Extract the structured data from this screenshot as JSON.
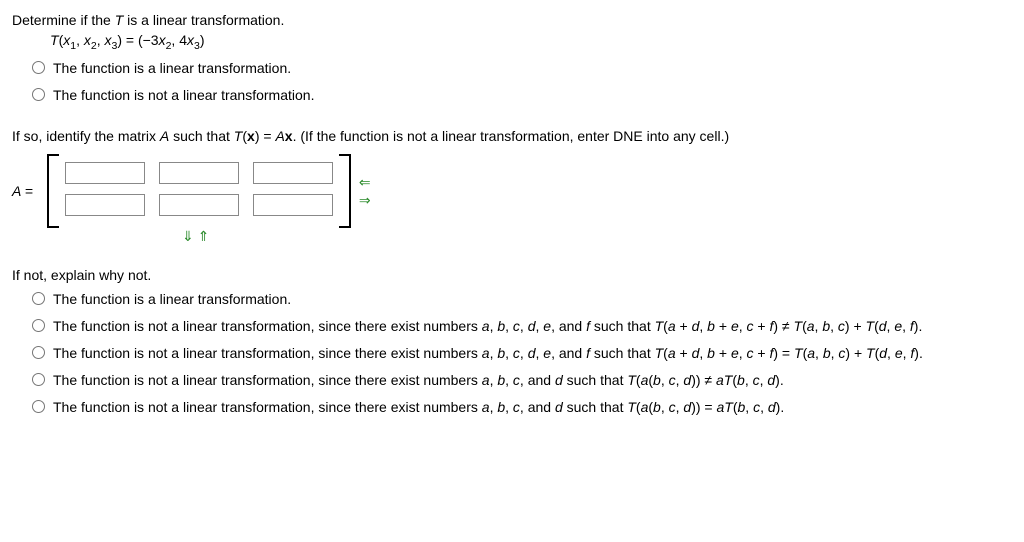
{
  "q1": {
    "prompt": "Determine if the T is a linear transformation.",
    "formula": "T(x₁, x₂, x₃) = (−3x₂, 4x₃)",
    "options": [
      "The function is a linear transformation.",
      "The function is not a linear transformation."
    ]
  },
  "q2": {
    "prompt": "If so, identify the matrix A such that T(x) = Ax. (If the function is not a linear transformation, enter DNE into any cell.)",
    "label": "A =",
    "cells": [
      "",
      "",
      "",
      "",
      "",
      ""
    ]
  },
  "q3": {
    "prompt": "If not, explain why not.",
    "options": [
      "The function is a linear transformation.",
      "The function is not a linear transformation, since there exist numbers a, b, c, d, e, and f such that T(a + d, b + e, c + f) ≠ T(a, b, c) + T(d, e, f).",
      "The function is not a linear transformation, since there exist numbers a, b, c, d, e, and f such that T(a + d, b + e, c + f) = T(a, b, c) + T(d, e, f).",
      "The function is not a linear transformation, since there exist numbers a, b, c, and d such that T(a(b, c, d)) ≠ aT(b, c, d).",
      "The function is not a linear transformation, since there exist numbers a, b, c, and d such that T(a(b, c, d)) = aT(b, c, d)."
    ]
  },
  "icons": {
    "col_remove": "⇐",
    "col_add": "⇒",
    "row_remove": "⇓",
    "row_add": "⇑"
  }
}
